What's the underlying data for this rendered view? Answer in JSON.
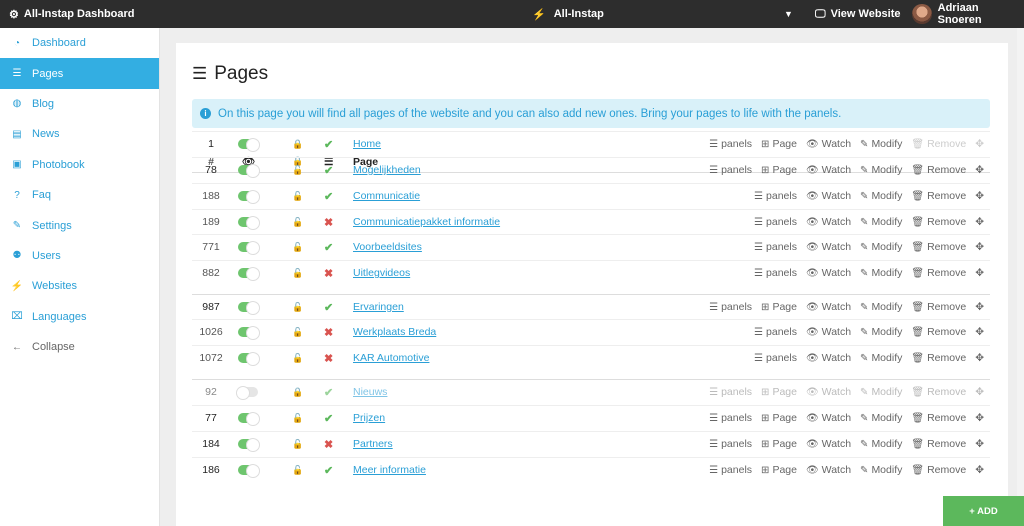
{
  "header": {
    "brand": "All-Instap Dashboard",
    "site_name": "All-Instap",
    "view_label": "View Website",
    "user_name": "Adriaan Snoeren"
  },
  "sidebar": {
    "items": [
      {
        "label": "Dashboard",
        "icon": "dashboard-icon",
        "glyph": "◔"
      },
      {
        "label": "Pages",
        "icon": "list-icon",
        "glyph": "☰"
      },
      {
        "label": "Blog",
        "icon": "globe-icon",
        "glyph": "◍"
      },
      {
        "label": "News",
        "icon": "document-icon",
        "glyph": "▤"
      },
      {
        "label": "Photobook",
        "icon": "image-icon",
        "glyph": "▣"
      },
      {
        "label": "Faq",
        "icon": "question-icon",
        "glyph": "?"
      },
      {
        "label": "Settings",
        "icon": "edit-icon",
        "glyph": "✎"
      },
      {
        "label": "Users",
        "icon": "users-icon",
        "glyph": "⚉"
      },
      {
        "label": "Websites",
        "icon": "plug-icon",
        "glyph": "⚡"
      },
      {
        "label": "Languages",
        "icon": "language-icon",
        "glyph": "⌧"
      },
      {
        "label": "Collapse",
        "icon": "arrow-left-icon",
        "glyph": "←"
      }
    ]
  },
  "main": {
    "title": "Pages",
    "info": "On this page you will find all pages of the website and you can also add new ones. Bring your pages to life with the panels.",
    "columns": {
      "id": "#",
      "page": "Page"
    },
    "actions": {
      "panels": "panels",
      "page": "Page",
      "watch": "Watch",
      "modify": "Modify",
      "remove": "Remove"
    },
    "rows": [
      {
        "id": "1",
        "page": "Home",
        "visible": true,
        "locked": true,
        "has_panels": true,
        "top": true,
        "add_page": true,
        "remove": false,
        "inactive": false
      },
      {
        "id": "78",
        "page": "Mogelijkheden",
        "visible": true,
        "locked": false,
        "has_panels": true,
        "top": true,
        "add_page": true,
        "remove": true,
        "inactive": false
      },
      {
        "id": "188",
        "page": "Communicatie",
        "visible": true,
        "locked": false,
        "has_panels": true,
        "top": false,
        "add_page": false,
        "remove": true,
        "inactive": false
      },
      {
        "id": "189",
        "page": "Communicatiepakket informatie",
        "visible": true,
        "locked": false,
        "has_panels": false,
        "top": false,
        "add_page": false,
        "remove": true,
        "inactive": false
      },
      {
        "id": "771",
        "page": "Voorbeeldsites",
        "visible": true,
        "locked": false,
        "has_panels": true,
        "top": false,
        "add_page": false,
        "remove": true,
        "inactive": false
      },
      {
        "id": "882",
        "page": "Uitlegvideos",
        "visible": true,
        "locked": false,
        "has_panels": false,
        "top": false,
        "add_page": false,
        "remove": true,
        "inactive": false
      },
      {
        "id": "987",
        "page": "Ervaringen",
        "visible": true,
        "locked": false,
        "has_panels": true,
        "top": true,
        "add_page": true,
        "remove": true,
        "inactive": false
      },
      {
        "id": "1026",
        "page": "Werkplaats Breda",
        "visible": true,
        "locked": false,
        "has_panels": false,
        "top": false,
        "add_page": false,
        "remove": true,
        "inactive": false
      },
      {
        "id": "1072",
        "page": "KAR Automotive",
        "visible": true,
        "locked": false,
        "has_panels": false,
        "top": false,
        "add_page": false,
        "remove": true,
        "inactive": false
      },
      {
        "id": "92",
        "page": "Nieuws",
        "visible": false,
        "locked": true,
        "has_panels": true,
        "top": true,
        "add_page": true,
        "remove": false,
        "inactive": true
      },
      {
        "id": "77",
        "page": "Prijzen",
        "visible": true,
        "locked": false,
        "has_panels": true,
        "top": true,
        "add_page": true,
        "remove": true,
        "inactive": false
      },
      {
        "id": "184",
        "page": "Partners",
        "visible": true,
        "locked": false,
        "has_panels": false,
        "top": true,
        "add_page": true,
        "remove": true,
        "inactive": false
      },
      {
        "id": "186",
        "page": "Meer informatie",
        "visible": true,
        "locked": false,
        "has_panels": true,
        "top": true,
        "add_page": true,
        "remove": true,
        "inactive": false
      }
    ]
  },
  "add_button": "+ ADD",
  "colors": {
    "topbar": "#2d2d2d",
    "accent": "#33aee2",
    "link": "#2a9fd6",
    "success": "#5cb85c",
    "danger": "#d9534f",
    "info_bg": "#d9f1f9"
  }
}
